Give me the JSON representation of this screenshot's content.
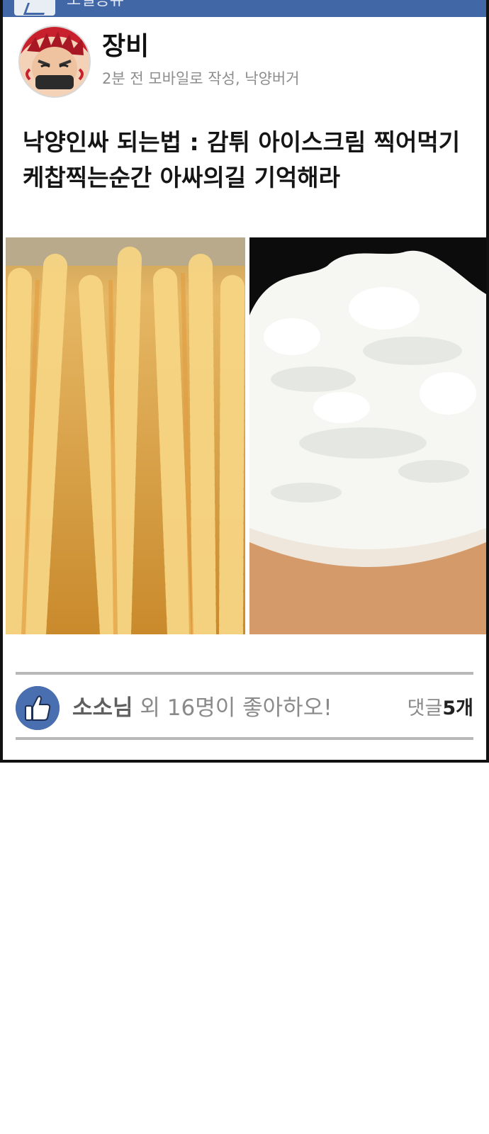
{
  "header": {
    "title_partial": "소셜공유"
  },
  "post": {
    "author": "장비",
    "meta": "2분 전 모바일로 작성, 낙양버거",
    "text_lines": [
      "낙양인싸 되는법 : 감튀 아이스크림 찍어먹기",
      "케찹찍는순간 아싸의길 기억해라"
    ],
    "images": [
      {
        "icon": "crinkle-fries-photo"
      },
      {
        "icon": "whipped-ice-cream-photo"
      }
    ]
  },
  "footer": {
    "like_name": "소소님",
    "like_rest": " 외 16명이 좋아하오!",
    "comment_label": "댓글",
    "comment_count": "5개"
  },
  "colors": {
    "header_blue": "#4267a6",
    "like_icon_blue": "#4a6fb0"
  }
}
